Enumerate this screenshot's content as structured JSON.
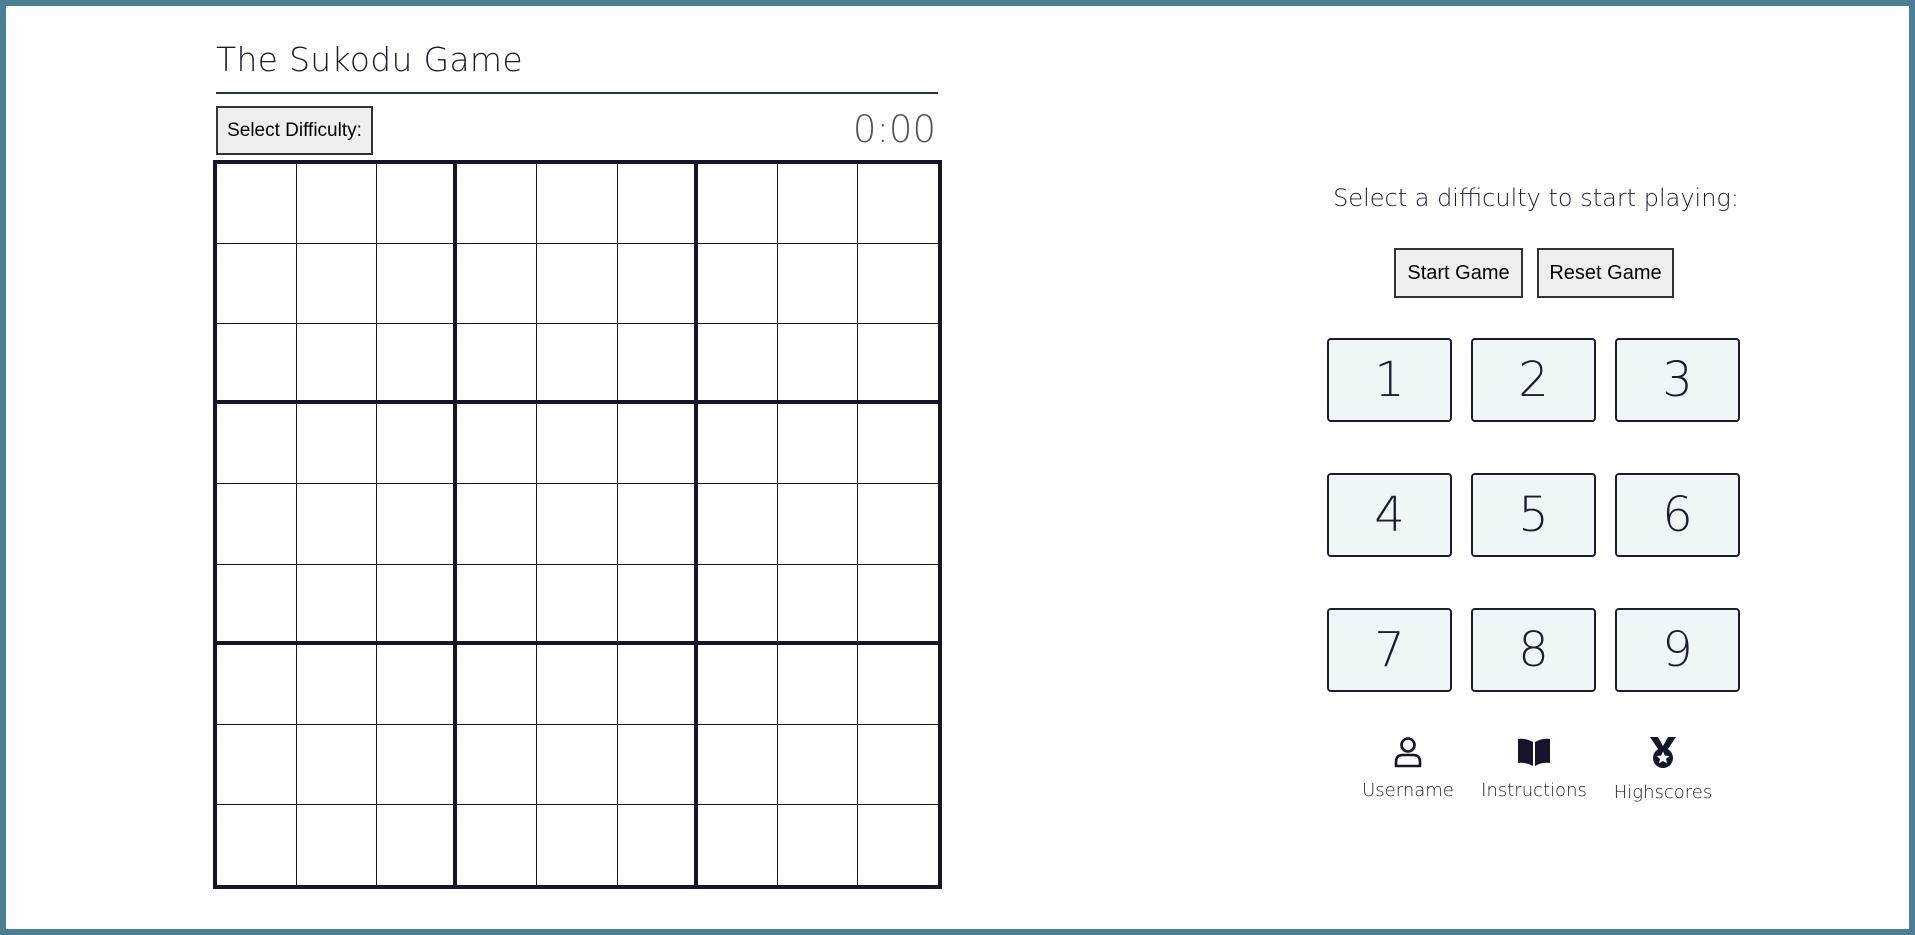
{
  "header": {
    "title": "The Sukodu Game"
  },
  "controls": {
    "difficulty_label": "Select Difficulty:",
    "timer": "0:00"
  },
  "board": {
    "rows": 9,
    "cols": 9,
    "values": [
      [
        "",
        "",
        "",
        "",
        "",
        "",
        "",
        "",
        ""
      ],
      [
        "",
        "",
        "",
        "",
        "",
        "",
        "",
        "",
        ""
      ],
      [
        "",
        "",
        "",
        "",
        "",
        "",
        "",
        "",
        ""
      ],
      [
        "",
        "",
        "",
        "",
        "",
        "",
        "",
        "",
        ""
      ],
      [
        "",
        "",
        "",
        "",
        "",
        "",
        "",
        "",
        ""
      ],
      [
        "",
        "",
        "",
        "",
        "",
        "",
        "",
        "",
        ""
      ],
      [
        "",
        "",
        "",
        "",
        "",
        "",
        "",
        "",
        ""
      ],
      [
        "",
        "",
        "",
        "",
        "",
        "",
        "",
        "",
        ""
      ],
      [
        "",
        "",
        "",
        "",
        "",
        "",
        "",
        "",
        ""
      ]
    ]
  },
  "side_panel": {
    "prompt": "Select a difficulty to start playing:",
    "start_label": "Start Game",
    "reset_label": "Reset Game",
    "numbers": [
      "1",
      "2",
      "3",
      "4",
      "5",
      "6",
      "7",
      "8",
      "9"
    ],
    "links": [
      {
        "label": "Username",
        "icon": "user-icon"
      },
      {
        "label": "Instructions",
        "icon": "book-icon"
      },
      {
        "label": "Highscores",
        "icon": "medal-icon"
      }
    ]
  },
  "colors": {
    "page_border": "#4a7f96",
    "text": "#1c1c2e",
    "number_button_bg": "#eef6f8",
    "grid_line": "#14142a"
  }
}
